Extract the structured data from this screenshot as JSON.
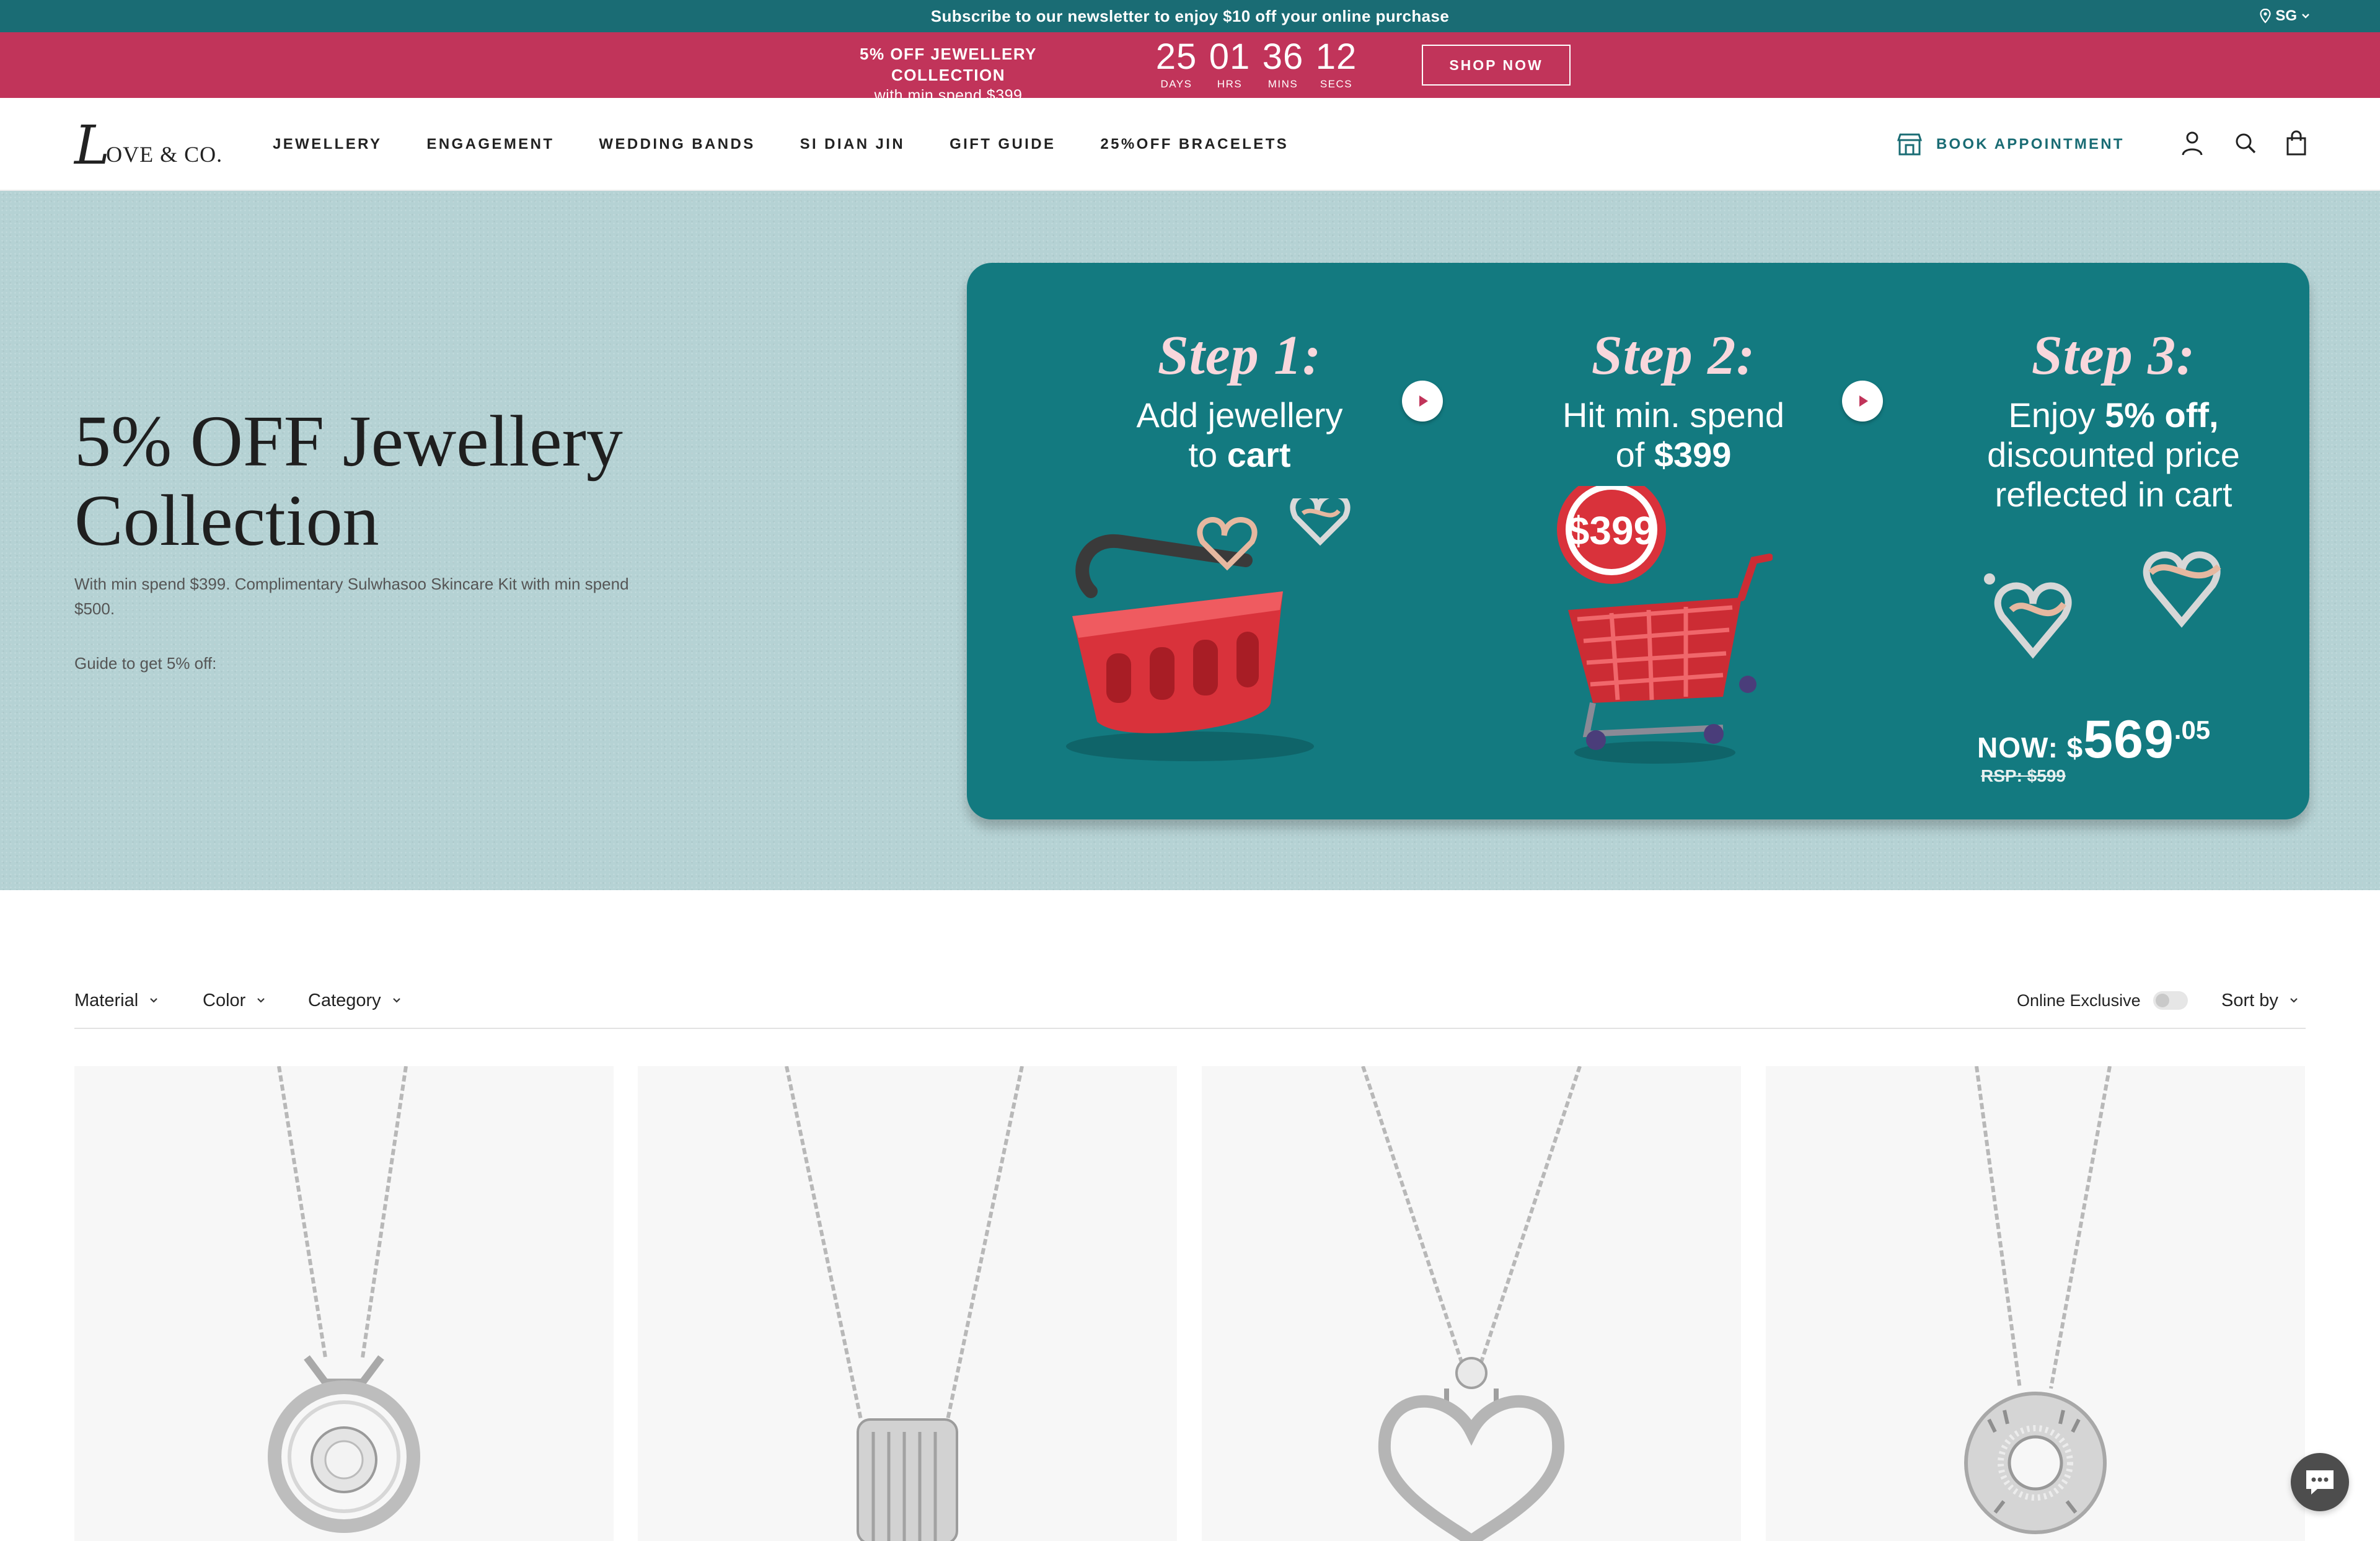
{
  "announcement": {
    "text": "Subscribe to our newsletter to enjoy $10 off your online purchase",
    "region": "SG"
  },
  "promo": {
    "title": "5% OFF JEWELLERY COLLECTION",
    "subtitle": "with min spend $399",
    "countdown": [
      {
        "value": "25",
        "label": "DAYS"
      },
      {
        "value": "01",
        "label": "HRS"
      },
      {
        "value": "36",
        "label": "MINS"
      },
      {
        "value": "12",
        "label": "SECS"
      }
    ],
    "button": "SHOP NOW"
  },
  "header": {
    "logo_initial": "L",
    "logo_text": "OVE & CO.",
    "nav": [
      "JEWELLERY",
      "ENGAGEMENT",
      "WEDDING BANDS",
      "SI DIAN JIN",
      "GIFT GUIDE",
      "25%OFF BRACELETS"
    ],
    "book_appointment": "BOOK APPOINTMENT",
    "icons": [
      "account-icon",
      "search-icon",
      "cart-icon"
    ]
  },
  "hero": {
    "title": "5% OFF Jewellery Collection",
    "description": "With min spend $399. Complimentary Sulwhasoo Skincare Kit with min spend $500.",
    "guide": "Guide to get 5% off:",
    "steps": [
      {
        "heading": "Step 1:",
        "line1": "Add jewellery",
        "line2_pre": "to ",
        "line2_bold": "cart"
      },
      {
        "heading": "Step 2:",
        "line1": "Hit min. spend",
        "line2_pre": "of ",
        "line2_bold": "$399"
      },
      {
        "heading": "Step 3:",
        "line1_pre": "Enjoy ",
        "line1_bold": "5% off,",
        "line2": "discounted price",
        "line3": "reflected in cart"
      }
    ],
    "badge_price": "$399",
    "now_label": "NOW: $",
    "now_value": "569",
    "now_cents": ".05",
    "rsp": "RSP: $599",
    "colors": {
      "card": "#137a80",
      "accent": "#c1345a",
      "hero_bg": "#b5d2d4"
    }
  },
  "filters": {
    "material": "Material",
    "color": "Color",
    "category": "Category",
    "online_exclusive": "Online Exclusive",
    "online_exclusive_on": false,
    "sort": "Sort by"
  },
  "products": [
    {
      "pendant": "round-solitaire-pendant"
    },
    {
      "pendant": "ribbed-barrel-pendant"
    },
    {
      "pendant": "heart-solitaire-pendant"
    },
    {
      "pendant": "roman-numeral-disc-pendant"
    }
  ]
}
